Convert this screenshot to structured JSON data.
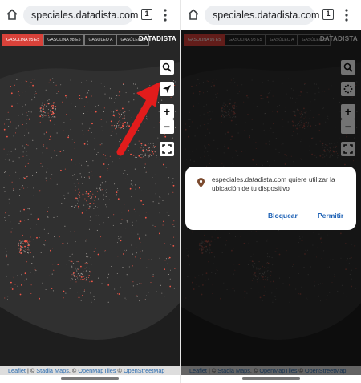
{
  "browser": {
    "url": "speciales.datadista.com",
    "tab_count": "1"
  },
  "map": {
    "fuel_tabs": [
      "GASOLINA 95 E5",
      "GASOLINA 98 E5",
      "GASÓLEO A",
      "GASÓLEO B"
    ],
    "active_fuel_index": 0,
    "brand": "DATADISTA",
    "zoom_in": "+",
    "zoom_out": "−",
    "attribution": {
      "leaflet": "Leaflet",
      "sep1": " | © ",
      "stadia": "Stadia Maps",
      "sep2": ", © ",
      "omt": "OpenMapTiles",
      "sep3": " © ",
      "osm": "OpenStreetMap"
    }
  },
  "dialog": {
    "message": "especiales.datadista.com quiere utilizar la ubicación de tu dispositivo",
    "block_label": "Bloquear",
    "allow_label": "Permitir"
  },
  "colors": {
    "active_tab": "#d9423a",
    "arrow": "#e21c1c",
    "link": "#1a5fb4"
  }
}
